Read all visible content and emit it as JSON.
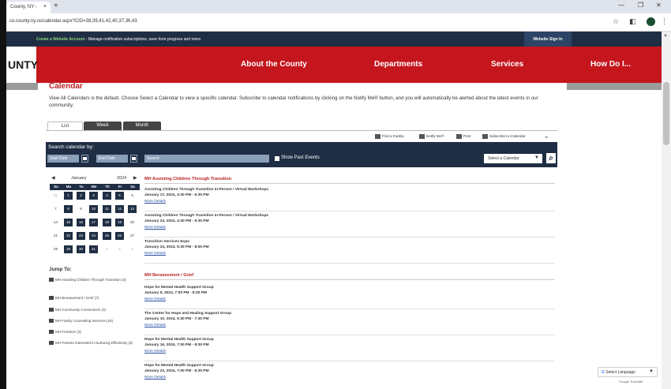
{
  "browser": {
    "tab_title": "County, NY -",
    "url": "co.county.ny.us/calendar.aspx?CID=38,39,41,42,40,37,36,43"
  },
  "site": {
    "top_message_link": "Create a Website Account",
    "top_message_text": " - Manage notification subscriptions, save form progress and more.",
    "sign_in": "Website Sign In",
    "logo": "UNTY",
    "nav": [
      "About the County",
      "Departments",
      "Services",
      "How Do I..."
    ]
  },
  "calendar": {
    "title": "Calendar",
    "description": "View All Calendars is the default. Choose Select a Calendar to view a specific calendar. Subscribe to calendar notifications by clicking on the Notify Me® button, and you will automatically be alerted about the latest events in our community.",
    "view_tabs": [
      "List",
      "Week",
      "Month"
    ],
    "tools": [
      "Find a Facility",
      "Notify Me®",
      "Print",
      "Subscribe to iCalendar"
    ],
    "search": {
      "label": "Search calendar by:",
      "start_date": "Start Date",
      "end_date": "End Date",
      "search_placeholder": "Search",
      "show_past": "Show Past Events",
      "select_calendar": "Select a Calendar"
    },
    "mini": {
      "month": "January",
      "year": "2024",
      "dow": [
        "Su",
        "Mo",
        "Tu",
        "We",
        "Th",
        "Fr",
        "Sa"
      ],
      "weeks": [
        [
          "31",
          "1",
          "2",
          "3",
          "4",
          "5",
          "6"
        ],
        [
          "7",
          "8",
          "9",
          "10",
          "11",
          "12",
          "13"
        ],
        [
          "14",
          "15",
          "16",
          "17",
          "18",
          "19",
          "20"
        ],
        [
          "21",
          "22",
          "23",
          "24",
          "25",
          "26",
          "27"
        ],
        [
          "28",
          "29",
          "30",
          "31",
          "1",
          "2",
          "3"
        ]
      ]
    },
    "jump_title": "Jump To:",
    "jump_items": [
      "MH Assisting Children Through Transition (3)",
      "MH Bereavement / Grief (7)",
      "MH Community Connections (3)",
      "MH Family Counseling Services (18)",
      "MH Freedom (3)",
      "MH Parents Interested in Nurturing Effectively (3)"
    ],
    "categories": [
      {
        "name": "MH Assisting Children Through Transition",
        "events": [
          {
            "title": "Assisting Children Through Transition In-Person / Virtual Workshops",
            "date": "January 17, 2024, 4:30 PM - 6:30 PM",
            "more": "More Details"
          },
          {
            "title": "Assisting Children Through Transition In-Person / Virtual Workshops",
            "date": "January 24, 2024, 4:30 PM - 6:30 PM",
            "more": "More Details"
          },
          {
            "title": "Transition Services Expo",
            "date": "January 24, 2024, 5:30 PM - 8:00 PM",
            "more": "More Details"
          }
        ]
      },
      {
        "name": "MH Bereavement / Grief",
        "events": [
          {
            "title": "Hope for Mental Health Support Group",
            "date": "January 9, 2024, 7:00 PM - 8:30 PM",
            "more": "More Details"
          },
          {
            "title": "The Center for Hope and Healing Support Group",
            "date": "January 10, 2024, 5:30 PM - 7:30 PM",
            "more": "More Details"
          },
          {
            "title": "Hope for Mental Health Support Group",
            "date": "January 16, 2024, 7:00 PM - 8:30 PM",
            "more": "More Details"
          },
          {
            "title": "Hope for Mental Health Support Group",
            "date": "January 23, 2024, 7:00 PM - 8:30 PM",
            "more": "More Details"
          }
        ]
      }
    ]
  },
  "translate": {
    "label": "Select Language",
    "powered": "Google Translate"
  }
}
